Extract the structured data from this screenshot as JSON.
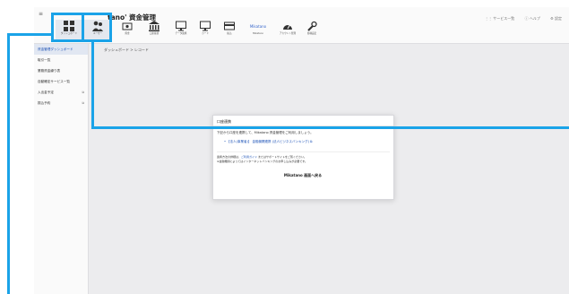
{
  "app": {
    "title": "tano' 資金管理",
    "menu_glyph": "≡"
  },
  "toolbar": {
    "tiles": [
      {
        "label": "ダッシュボード",
        "icon": "dashboard-icon"
      },
      {
        "label": "ユーザー",
        "icon": "users-icon"
      },
      {
        "label": "資金",
        "icon": "money-icon"
      },
      {
        "label": "口座振替",
        "icon": "bank-icon"
      },
      {
        "label": "データ連携",
        "icon": "monitor-icon"
      },
      {
        "label": "カード",
        "icon": "monitor-icon"
      },
      {
        "label": "振込",
        "icon": "card-icon"
      },
      {
        "label": "Mikatano",
        "icon": "logo-icon"
      },
      {
        "label": "アカウント管理",
        "icon": "speedometer-icon"
      },
      {
        "label": "各種設定",
        "icon": "wrench-icon"
      }
    ]
  },
  "top_right": {
    "service_list": "サービス一覧",
    "help": "ヘルプ",
    "settings": "設定"
  },
  "sidebar": {
    "items": [
      {
        "label": "資金管理ダッシュボード",
        "active": true,
        "ext": ""
      },
      {
        "label": "取引一覧",
        "active": false,
        "ext": ""
      },
      {
        "label": "業務資金繰り表",
        "active": false,
        "ext": ""
      },
      {
        "label": "自動確定サービス一覧",
        "active": false,
        "ext": ""
      },
      {
        "label": "入出金予定",
        "active": false,
        "ext": "⧉"
      },
      {
        "label": "振込予約",
        "active": false,
        "ext": "⧉"
      }
    ]
  },
  "breadcrumb": "ダッシュボード > レコード",
  "modal": {
    "title": "口座連携",
    "intro": "下記から口座を連携して、Mikatano 資金管理をご利用しましょう。",
    "link": "• 【法人(事業者)】 金融機関連携 (法人ビジネスバンキング) ⧉",
    "note1_prefix": "連携方法の詳細は、",
    "note1_link": "ご利用ガイド",
    "note1_suffix": " またはサポートサイトをご覧ください。",
    "note2": "※金融機関によってはインターネットバンキングのお申し込みが必要です。",
    "button": "Mikatano 画面へ戻る"
  },
  "colors": {
    "accent": "#1f54b8",
    "annotation": "#1aa3e8"
  }
}
